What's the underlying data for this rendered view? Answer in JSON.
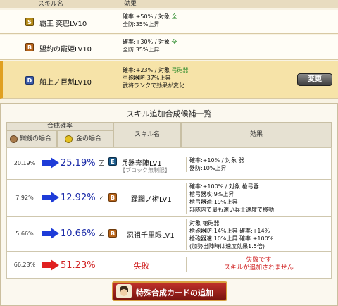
{
  "top_table": {
    "col_skill": "スキル名",
    "col_effect": "効果",
    "rows": [
      {
        "rank": "S",
        "name": "覇王 奕巴LV10",
        "effect1": "確率:+50% / 対象 ",
        "target": "全",
        "effect2": "全防:35%上昇"
      },
      {
        "rank": "B",
        "name": "盟約の寵姫LV10",
        "effect1": "確率:+30% / 対象 ",
        "target": "全",
        "effect2": "全防:35%上昇"
      },
      {
        "rank": "D",
        "name": "船上ノ巨魁LV10",
        "effect1": "確率:+23% / 対象 ",
        "target": "弓砲器",
        "effect2": "弓砲器防:37%上昇",
        "effect3": "武将ランクで効果が変化"
      }
    ],
    "change_button": "変更"
  },
  "candidates": {
    "title": "スキル追加合成候補一覧",
    "col_rate": "合成確率",
    "col_copper": "銅銭の場合",
    "col_gold": "金の場合",
    "col_skill": "スキル名",
    "col_effect": "効果",
    "rows": [
      {
        "copper": "20.19%",
        "gold": "25.19%",
        "rank": "E",
        "name": "兵器奔陣LV1",
        "sub": "【ブロック無制限】",
        "effects": [
          "確率:+10% / 対象 器",
          "器防:10%上昇"
        ],
        "checked": "✓"
      },
      {
        "copper": "7.92%",
        "gold": "12.92%",
        "rank": "B",
        "name": "蹂躙ノ術LV1",
        "sub": "",
        "effects": [
          "確率:+100% / 対象 槍弓器",
          "槍弓器攻:9%上昇",
          "槍弓器速:19%上昇",
          "部隊内で最も速い兵士速度で移動"
        ],
        "checked": "✓"
      },
      {
        "copper": "5.66%",
        "gold": "10.66%",
        "rank": "B",
        "name": "忍祖千里眼LV1",
        "sub": "",
        "effects": [
          "対象 槍砲器",
          "槍砲器防:14%上昇 確率:+14%",
          "槍砲器速:10%上昇 確率:+100%",
          "(加勢出陣時は速度効果1.5倍)"
        ],
        "checked": "✓"
      },
      {
        "copper": "66.23%",
        "gold": "51.23%",
        "rank": "",
        "name": "失敗",
        "sub": "",
        "effects": [
          "失敗です",
          "スキルが追加されません"
        ],
        "checked": ""
      }
    ],
    "special_button": "特殊合成カードの追加"
  },
  "colors": {
    "arrow_blue": "#1e3cd8",
    "arrow_red": "#e02020",
    "selected_row": "#f6e3a8"
  }
}
